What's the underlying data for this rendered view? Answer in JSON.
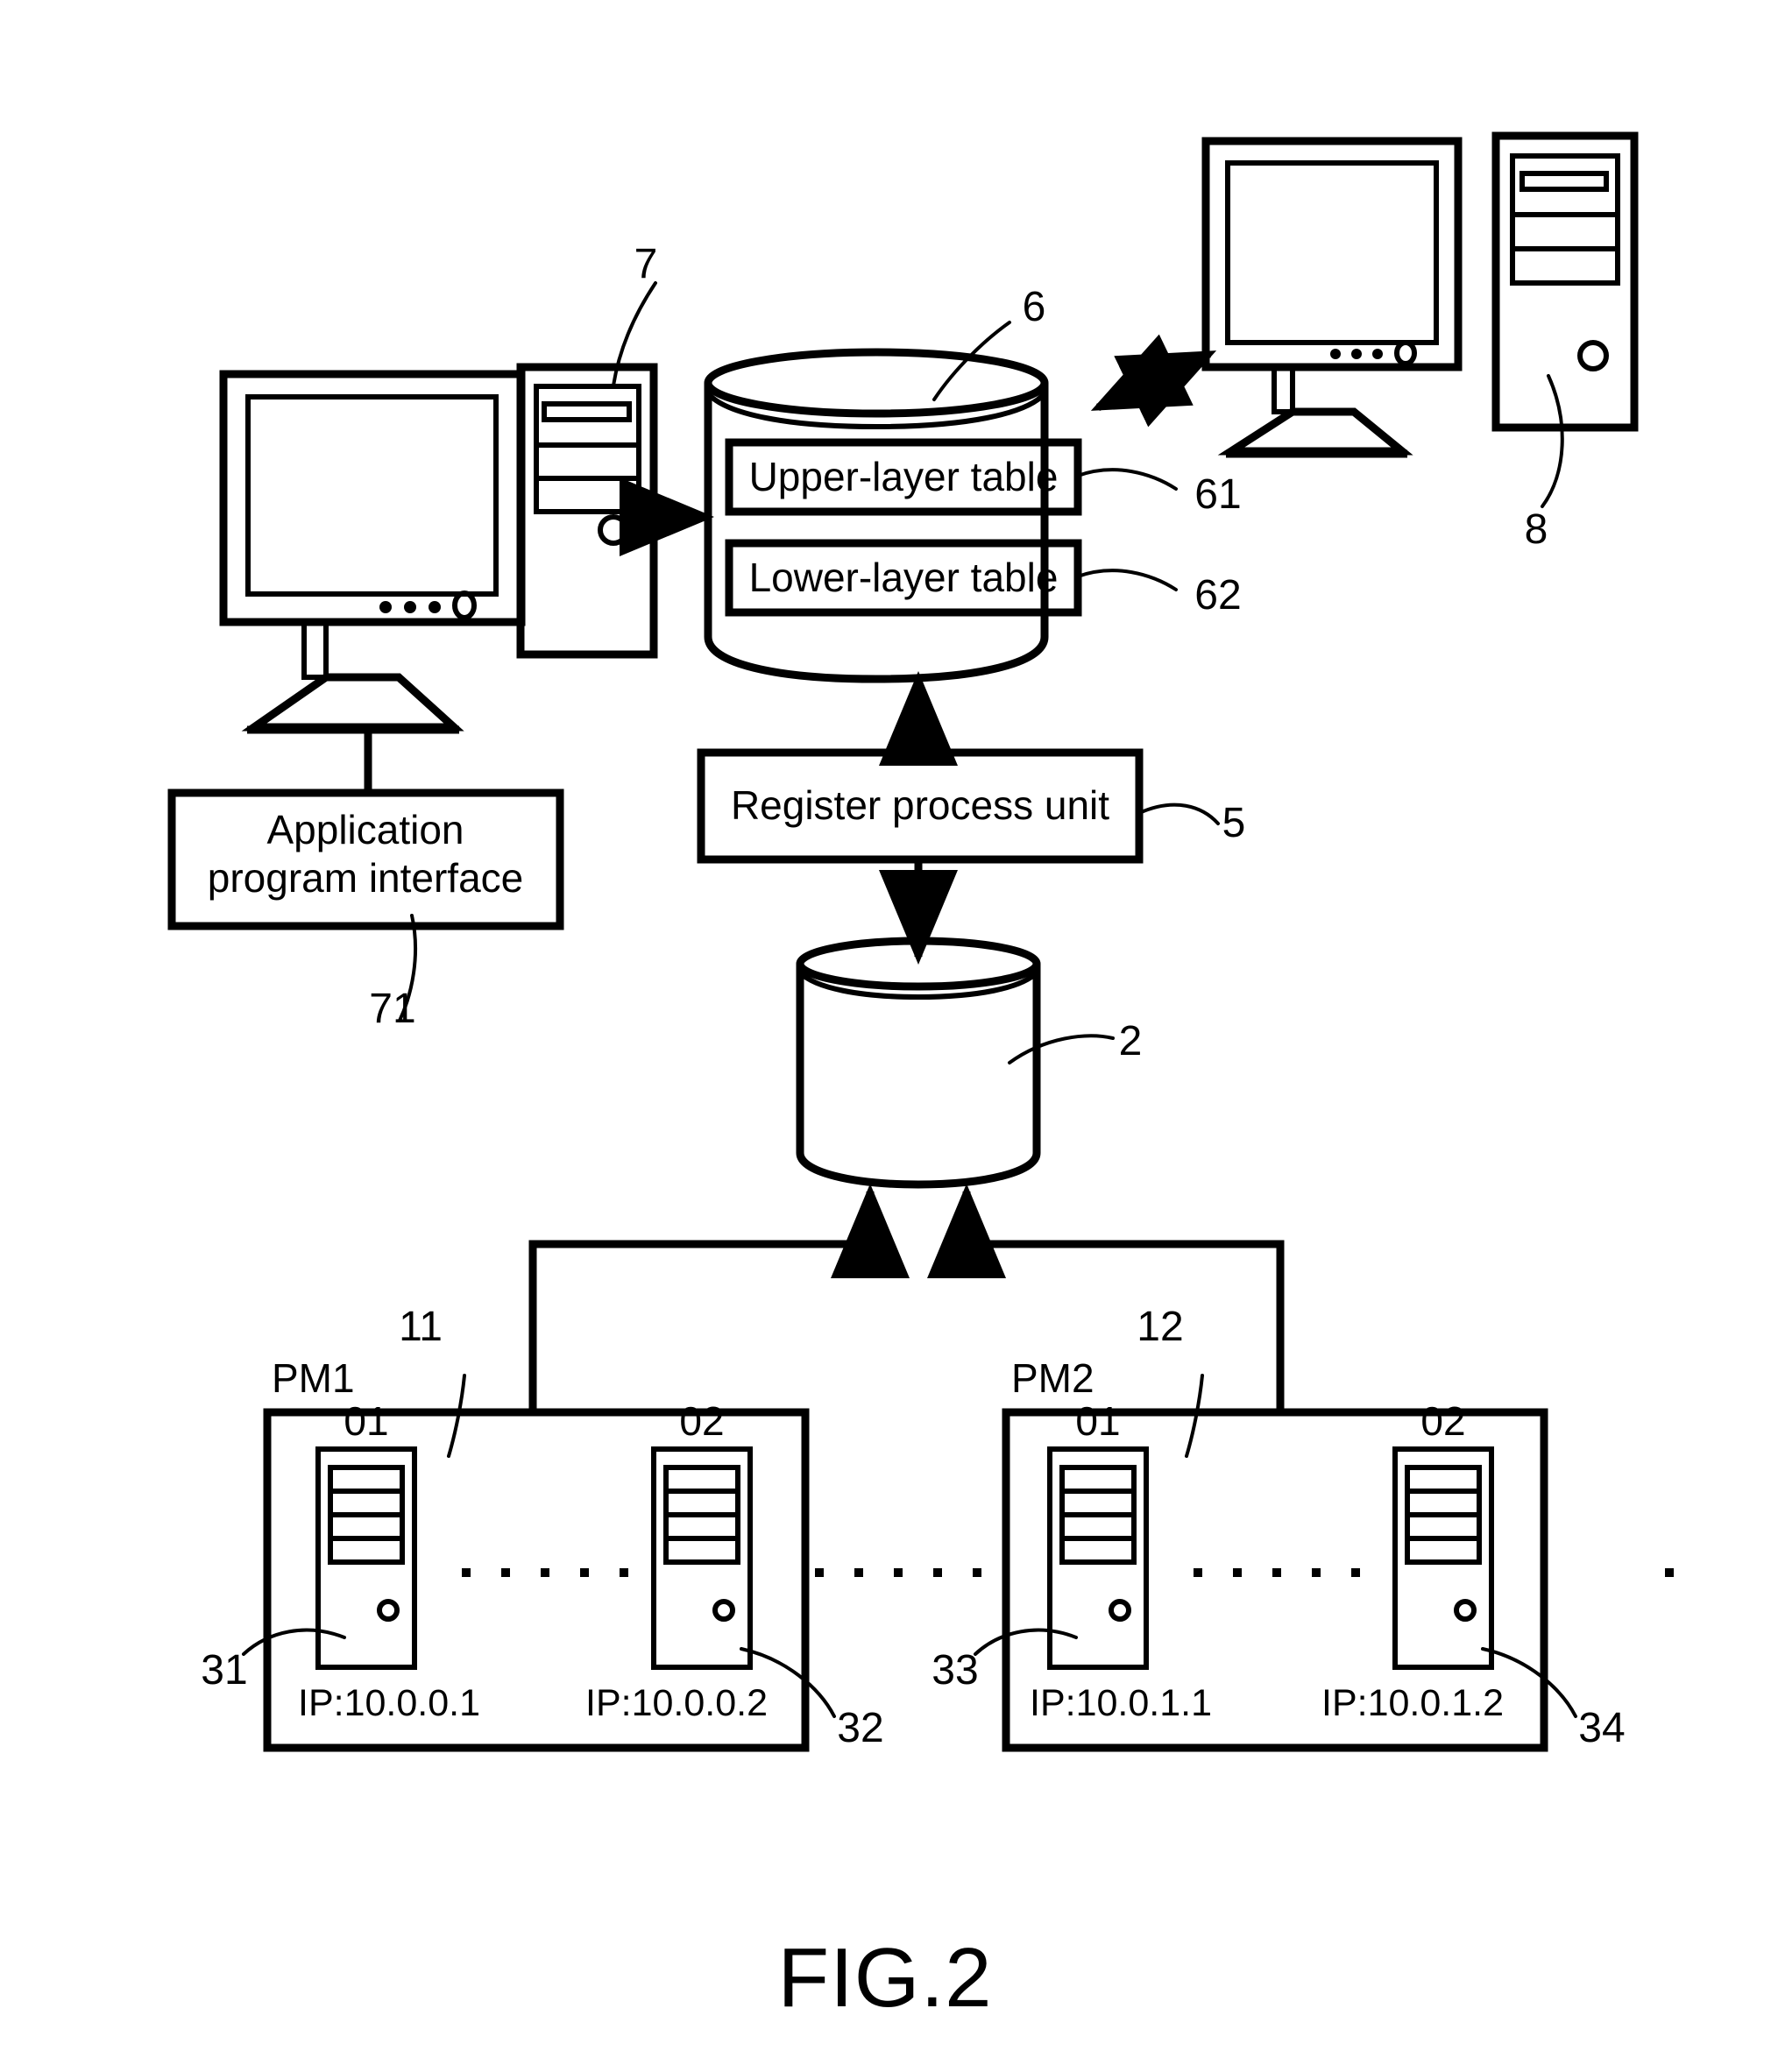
{
  "figure": {
    "caption": "FIG.2",
    "title": "FIG.2"
  },
  "boxes": {
    "upper_layer_table": "Upper-layer table",
    "lower_layer_table": "Lower-layer table",
    "application_program_interface": "Application\nprogram interface",
    "api_line1": "Application",
    "api_line2": "program interface",
    "register_process_unit": "Register process unit"
  },
  "reference_numerals": {
    "api": "71",
    "client_tower": "7",
    "database_6": "6",
    "upper_table": "61",
    "lower_table": "62",
    "remote_tower": "8",
    "register_unit": "5",
    "central_store": "2",
    "pm1_ref": "11",
    "pm2_ref": "12",
    "vm_pm1_01": "31",
    "vm_pm1_02": "32",
    "vm_pm2_01": "33",
    "vm_pm2_02": "34"
  },
  "physical_machines": [
    {
      "name": "PM1",
      "ref": "11",
      "vms": [
        {
          "index": "01",
          "ip": "IP:10.0.0.1",
          "ref": "31"
        },
        {
          "index": "02",
          "ip": "IP:10.0.0.2",
          "ref": "32"
        }
      ]
    },
    {
      "name": "PM2",
      "ref": "12",
      "vms": [
        {
          "index": "01",
          "ip": "IP:10.0.1.1",
          "ref": "33"
        },
        {
          "index": "02",
          "ip": "IP:10.0.1.2",
          "ref": "34"
        }
      ]
    }
  ],
  "icons": {
    "monitor_left": "monitor-icon",
    "tower_left": "computer-tower-icon",
    "monitor_right": "monitor-icon",
    "tower_right": "computer-tower-icon",
    "database_cylinder": "database-cylinder-icon",
    "storage_cylinder": "storage-cylinder-icon",
    "server_unit": "server-rack-icon"
  },
  "colors": {
    "line": "#000000",
    "background": "#ffffff"
  }
}
